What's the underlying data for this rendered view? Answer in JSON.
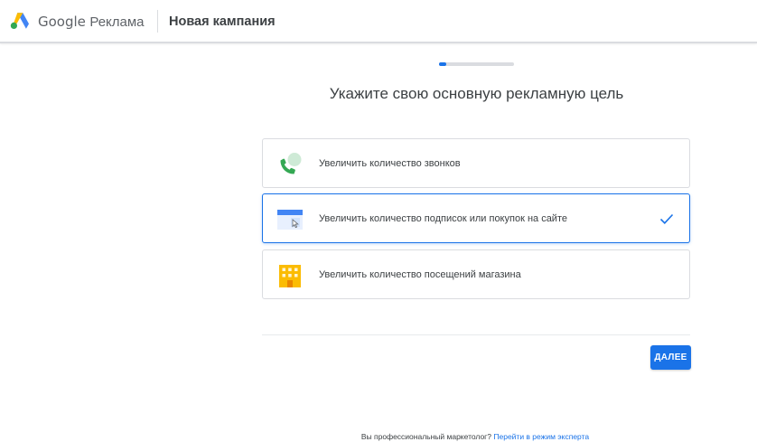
{
  "header": {
    "brand_google": "Google",
    "brand_product": "Реклама",
    "title": "Новая кампания"
  },
  "progress": {
    "percent": 10
  },
  "heading": "Укажите свою основную рекламную цель",
  "options": [
    {
      "label": "Увеличить количество звонков",
      "icon": "phone-icon",
      "selected": false
    },
    {
      "label": "Увеличить количество подписок или покупок на сайте",
      "icon": "website-icon",
      "selected": true
    },
    {
      "label": "Увеличить количество посещений магазина",
      "icon": "store-icon",
      "selected": false
    }
  ],
  "next_button": {
    "label": "ДАЛЕЕ"
  },
  "footer": {
    "question": "Вы профессиональный маркетолог?",
    "link_label": "Перейти в режим эксперта"
  },
  "colors": {
    "accent": "#1a73e8",
    "ads_blue": "#4285f4",
    "ads_yellow": "#fbbc04",
    "ads_green": "#34a853"
  }
}
